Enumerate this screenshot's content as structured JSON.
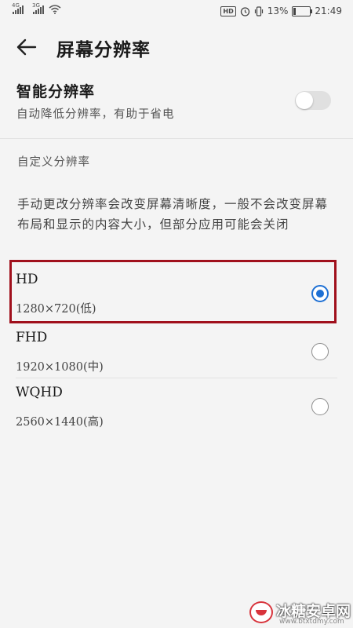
{
  "status_bar": {
    "sim1_type": "4G",
    "sim2_type": "3G",
    "hd_badge": "HD",
    "battery_percent": "13%",
    "battery_level": 0.13,
    "time": "21:49"
  },
  "app_bar": {
    "title": "屏幕分辨率"
  },
  "smart_resolution": {
    "title": "智能分辨率",
    "subtitle": "自动降低分辨率，有助于省电",
    "enabled": false
  },
  "custom_section": {
    "header": "自定义分辨率",
    "description": "手动更改分辨率会改变屏幕清晰度，一般不会改变屏幕布局和显示的内容大小，但部分应用可能会关闭"
  },
  "options": [
    {
      "name": "HD",
      "resolution": "1280×720(低)",
      "selected": true
    },
    {
      "name": "FHD",
      "resolution": "1920×1080(中)",
      "selected": false
    },
    {
      "name": "WQHD",
      "resolution": "2560×1440(高)",
      "selected": false
    }
  ],
  "colors": {
    "accent": "#1e70d4",
    "highlight_border": "#a0101c"
  },
  "watermark": {
    "text": "冰糖安卓网",
    "url": "www.btxtdmy.com"
  }
}
